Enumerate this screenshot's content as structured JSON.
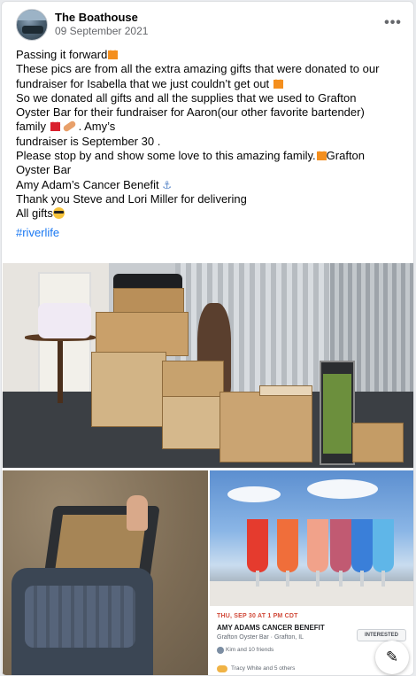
{
  "post": {
    "page_name": "The Boathouse",
    "date": "09 September 2021",
    "more_label": "•••",
    "lines": [
      "Passing it forward",
      "These pics are from all the extra amazing gifts  that were donated to our",
      "fundraiser for Isabella that we just couldn’t get out",
      "So we donated all gifts and all the supplies that we used to Grafton",
      "Oyster Bar for their fundraiser for Aaron(our other favorite bartender)",
      "family",
      ". Amy’s",
      "fundraiser is September 30 .",
      "Please stop by and show some love to this amazing family.",
      "Grafton",
      "Oyster Bar",
      "Amy Adam’s Cancer Benefit",
      "Thank you Steve and Lori Miller for delivering",
      "All gifts"
    ],
    "hashtag": "#riverlife"
  },
  "event": {
    "date": "THU, SEP 30 AT 1 PM CDT",
    "title": "AMY ADAMS CANCER BENEFIT",
    "location": "Grafton Oyster Bar · Grafton, IL",
    "button": "INTERESTED",
    "friends": "Kim and 10 friends",
    "going": "Tracy White and 5 others"
  },
  "icons": {
    "more": "more-horizontal-icon",
    "edit": "edit-compose-icon",
    "anchor": "⚓",
    "edit_glyph": "✎"
  },
  "colors": {
    "hashtag": "#1877f2",
    "heart_orange": "#f48f1e",
    "heart_red": "#d9202e",
    "event_date": "#d14a3a"
  }
}
